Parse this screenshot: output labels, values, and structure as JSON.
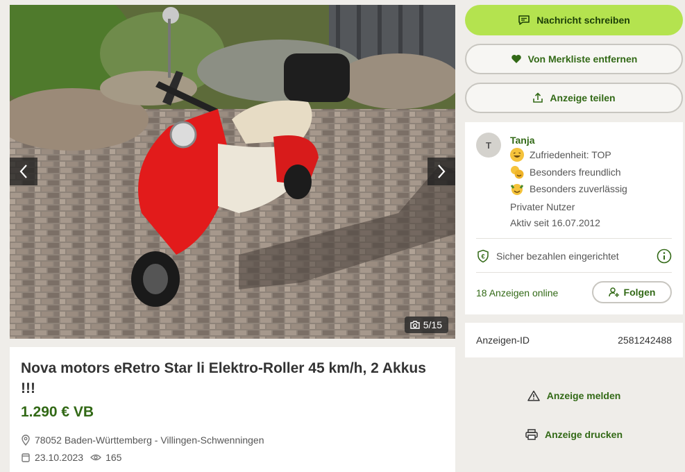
{
  "gallery": {
    "counter": "5/15",
    "prev_icon": "chevron-left-icon",
    "next_icon": "chevron-right-icon",
    "camera_icon": "camera-icon"
  },
  "listing": {
    "title": "Nova motors eRetro Star li Elektro-Roller 45 km/h, 2 Akkus !!!",
    "price": "1.290 € VB",
    "location": "78052 Baden-Württemberg - Villingen-Schwenningen",
    "date": "23.10.2023",
    "views": "165"
  },
  "actions": {
    "message": "Nachricht schreiben",
    "watchlist_remove": "Von Merkliste entfernen",
    "share": "Anzeige teilen",
    "report": "Anzeige melden",
    "print": "Anzeige drucken"
  },
  "seller": {
    "avatar_initial": "T",
    "name": "Tanja",
    "badges": [
      {
        "label": "Zufriedenheit: TOP",
        "icon": "laughing-face-icon"
      },
      {
        "label": "Besonders freundlich",
        "icon": "friendly-faces-icon"
      },
      {
        "label": "Besonders zuverlässig",
        "icon": "reliable-face-icon"
      }
    ],
    "type": "Privater Nutzer",
    "active_since": "Aktiv seit 16.07.2012",
    "secure_payment": "Sicher bezahlen eingerichtet",
    "ads_online": "18 Anzeigen online",
    "follow": "Folgen"
  },
  "ad_id": {
    "label": "Anzeigen-ID",
    "value": "2581242488"
  },
  "colors": {
    "accent_green": "#326916",
    "primary_button": "#b4e34f",
    "background": "#efede9"
  }
}
